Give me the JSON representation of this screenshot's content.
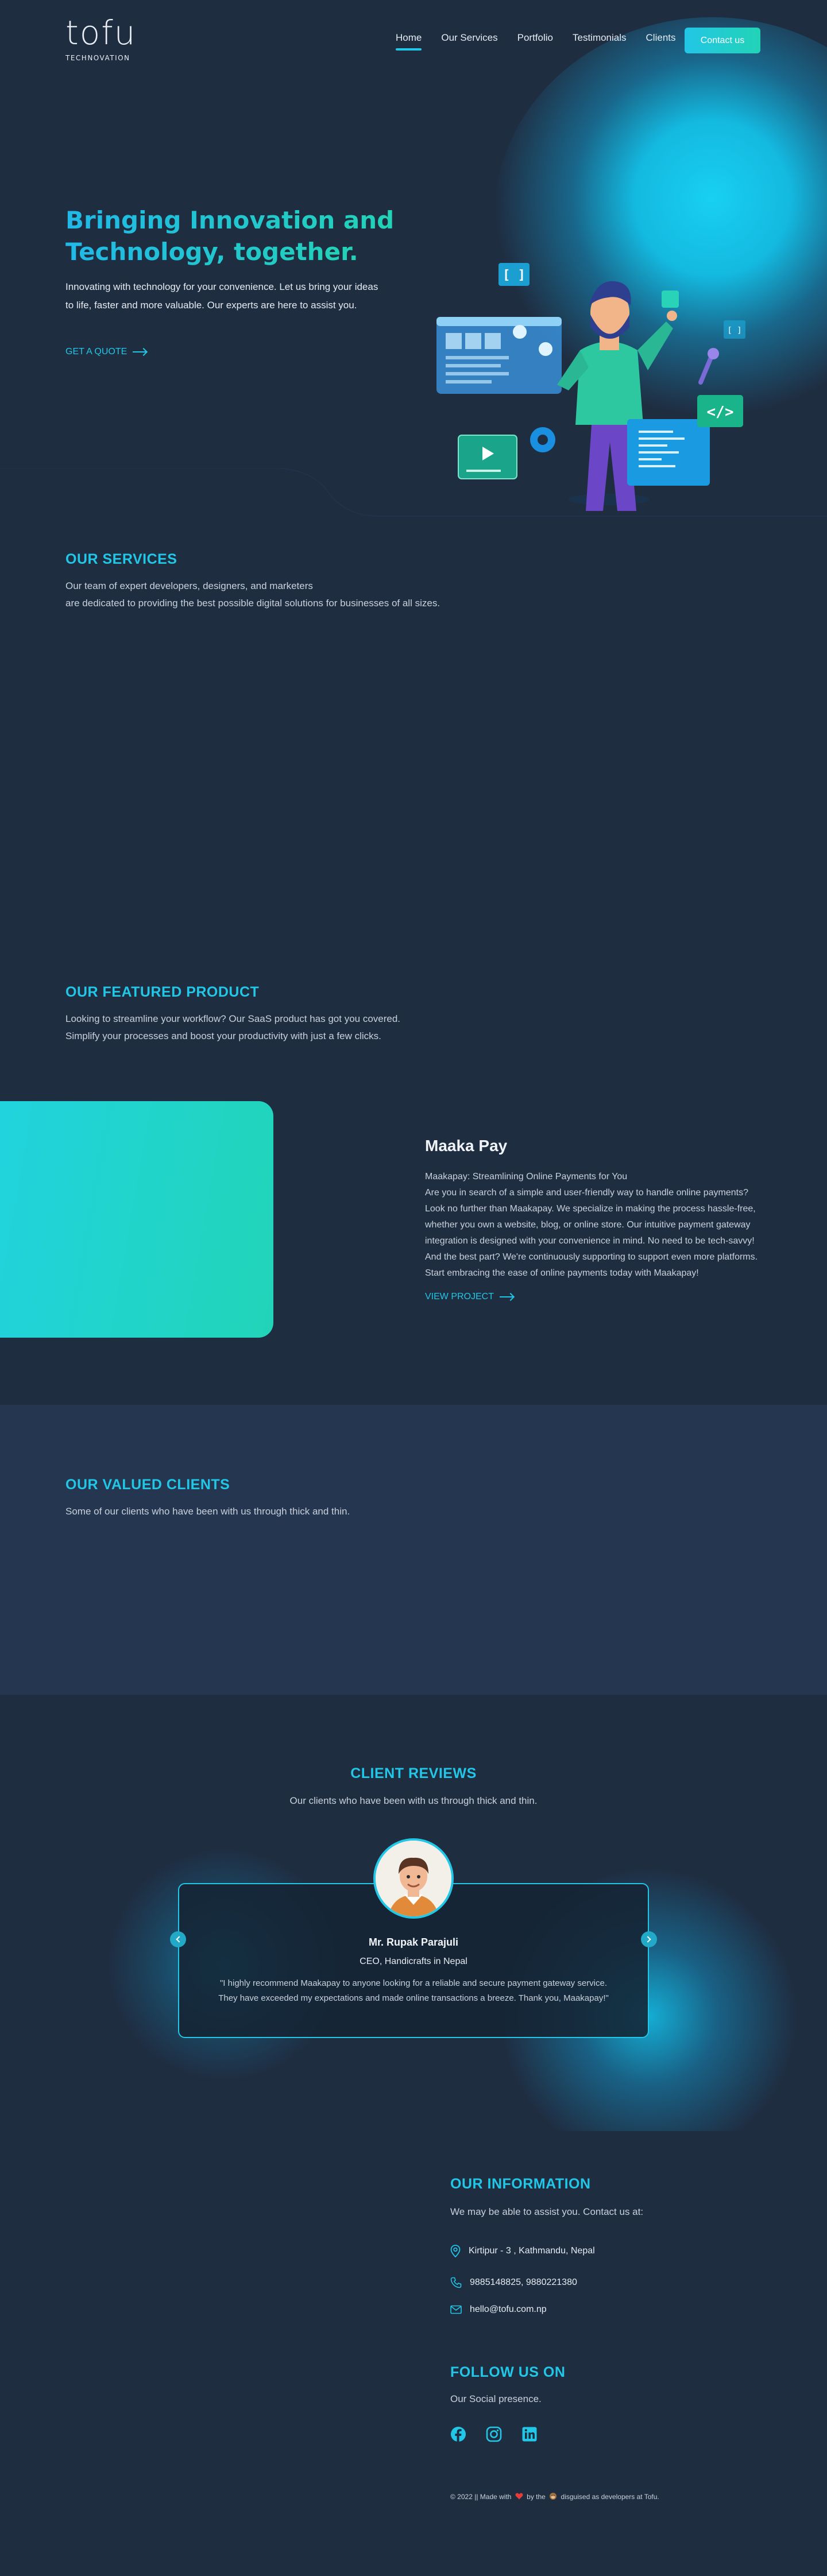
{
  "header": {
    "logo_word": "tofu",
    "logo_sub": "TECHNOVATION",
    "nav": [
      "Home",
      "Our Services",
      "Portfolio",
      "Testimonials",
      "Clients"
    ],
    "active_nav": "Home",
    "contact_button": "Contact us"
  },
  "hero": {
    "title_line1": "Bringing Innovation and",
    "title_line2": "Technology, together.",
    "text": "Innovating with technology for your convenience. Let us bring your ideas to life, faster and more valuable. Our experts are here to assist you.",
    "cta": "GET A QUOTE",
    "illustration": {
      "code_tag": "</>",
      "brackets": "[ ]",
      "small_bracket": "[ ]"
    }
  },
  "services": {
    "title": "OUR SERVICES",
    "text_line1": "Our team of expert developers, designers, and marketers",
    "text_line2": "are dedicated to providing the best possible digital solutions for businesses of all sizes."
  },
  "featured": {
    "title": "OUR FEATURED PRODUCT",
    "text_line1": "Looking to streamline your workflow? Our SaaS product has got you covered.",
    "text_line2": "Simplify your processes and boost your productivity with just a few clicks.",
    "product": {
      "name": "Maaka Pay",
      "description": "Maakapay: Streamlining Online Payments for You Are you in search of a simple and user-friendly way to handle online payments? Look no further than Maakapay. We specialize in making the process hassle-free, whether you own a website, blog, or online store. Our intuitive payment gateway integration is designed with your convenience in mind. No need to be tech-savvy! And the best part? We're continuously supporting to support even more platforms. Start embracing the ease of online payments today with Maakapay!",
      "desc_lines": [
        "Maakapay: Streamlining Online Payments for You",
        "Are you in search of a simple and user-friendly way to handle online payments?",
        "Look no further than Maakapay. We specialize in making the process hassle-free,",
        "whether you own a website, blog, or online store. Our intuitive payment gateway",
        "integration is designed with your convenience in mind. No need to be tech-savvy!",
        "And the best part? We're continuously supporting to support even more platforms.",
        "Start embracing the ease of online payments today with Maakapay!"
      ],
      "cta": "VIEW PROJECT"
    }
  },
  "clients": {
    "title": "OUR VALUED CLIENTS",
    "text": "Some of our clients who have been with us through thick and thin."
  },
  "reviews": {
    "title": "CLIENT REVIEWS",
    "text": "Our clients who have been with us through thick and thin.",
    "review": {
      "name": "Mr. Rupak Parajuli",
      "role": "CEO, Handicrafts in Nepal",
      "quote": "\"I highly recommend Maakapay to anyone looking for a reliable and secure payment gateway service. They have exceeded my expectations and made online transactions a breeze. Thank you, Maakapay!\""
    }
  },
  "footer": {
    "info_title": "OUR INFORMATION",
    "info_text": "We may be able to assist you. Contact us at:",
    "address": "Kirtipur - 3 , Kathmandu, Nepal",
    "phone": "9885148825, 9880221380",
    "email": "hello@tofu.com.np",
    "follow_title": "FOLLOW US ON",
    "follow_text": "Our Social presence.",
    "socials": [
      "facebook-icon",
      "instagram-icon",
      "linkedin-icon"
    ],
    "copyright_prefix": "© 2022 || Made with",
    "copyright_middle": "by the",
    "copyright_suffix": "disguised as developers at Tofu."
  },
  "colors": {
    "background": "#1f2d41",
    "accent": "#22c6e6",
    "accent_green": "#22d3b6",
    "clients_band": "#243650"
  }
}
